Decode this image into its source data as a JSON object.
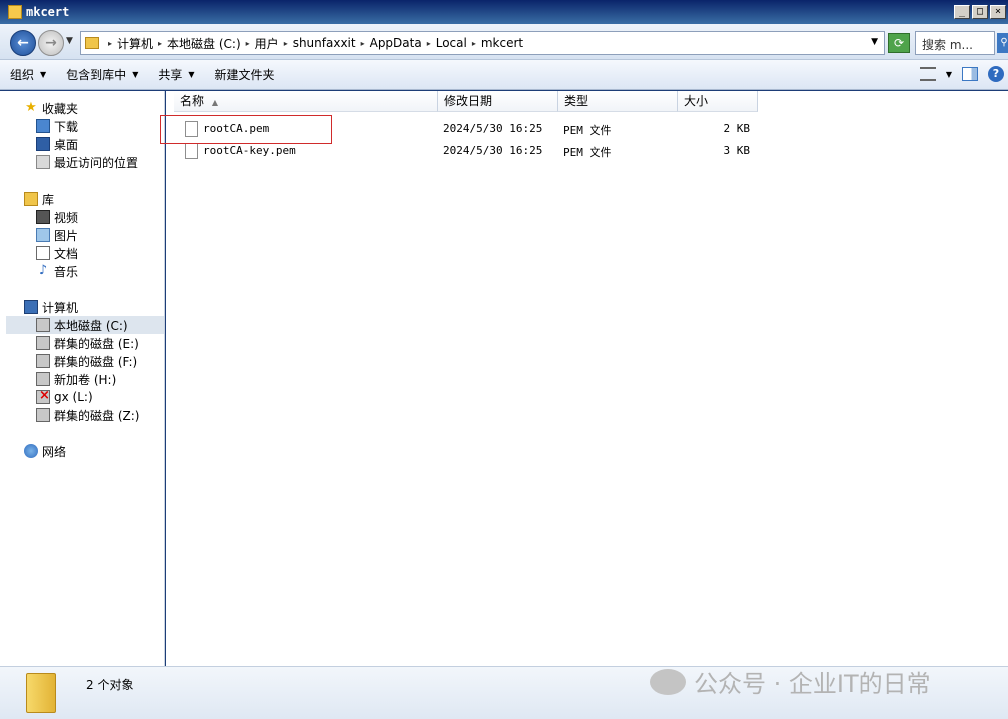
{
  "window": {
    "title": "mkcert"
  },
  "address": {
    "crumbs": [
      "计算机",
      "本地磁盘 (C:)",
      "用户",
      "shunfaxxit",
      "AppData",
      "Local",
      "mkcert"
    ],
    "search_placeholder": "搜索 m..."
  },
  "toolbar": {
    "organize": "组织",
    "include_library": "包含到库中",
    "share": "共享",
    "new_folder": "新建文件夹"
  },
  "nav": {
    "favorites": "收藏夹",
    "downloads": "下载",
    "desktop": "桌面",
    "recent": "最近访问的位置",
    "libraries": "库",
    "videos": "视频",
    "pictures": "图片",
    "documents": "文档",
    "music": "音乐",
    "computer": "计算机",
    "drive_c": "本地磁盘 (C:)",
    "drive_e": "群集的磁盘 (E:)",
    "drive_f": "群集的磁盘 (F:)",
    "drive_h": "新加卷 (H:)",
    "drive_l": "gx (L:)",
    "drive_z": "群集的磁盘 (Z:)",
    "network": "网络"
  },
  "columns": {
    "name": "名称",
    "modified": "修改日期",
    "type": "类型",
    "size": "大小"
  },
  "files": [
    {
      "name": "rootCA.pem",
      "modified": "2024/5/30 16:25",
      "type": "PEM 文件",
      "size": "2 KB"
    },
    {
      "name": "rootCA-key.pem",
      "modified": "2024/5/30 16:25",
      "type": "PEM 文件",
      "size": "3 KB"
    }
  ],
  "status": {
    "count": "2 个对象"
  },
  "watermark": {
    "text": "公众号 · 企业IT的日常"
  }
}
